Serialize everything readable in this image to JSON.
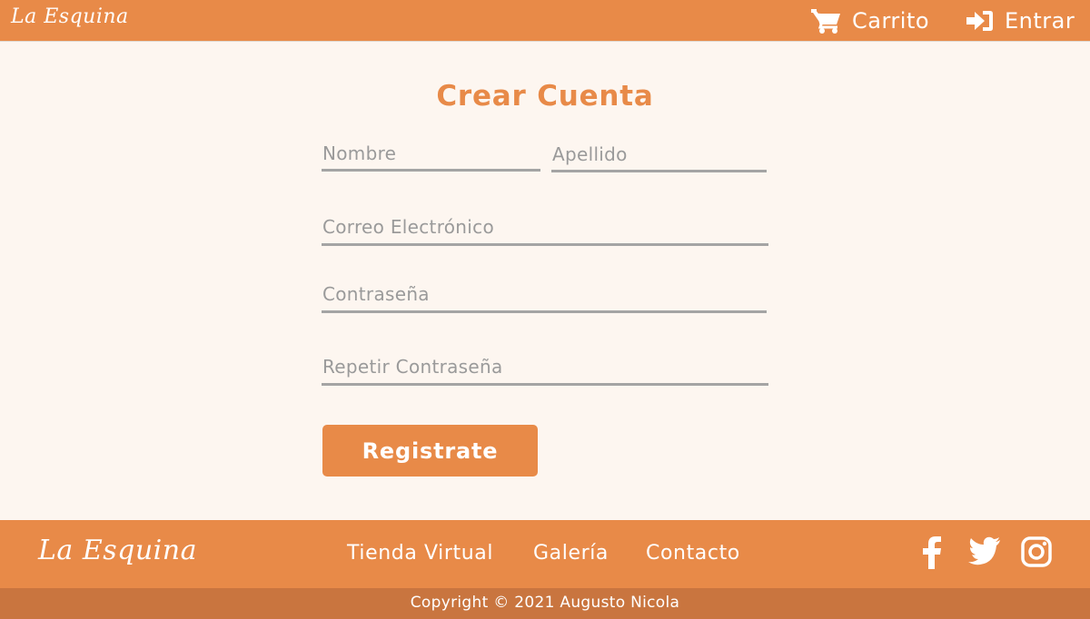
{
  "header": {
    "logo": "La Esquina",
    "cart_label": "Carrito",
    "login_label": "Entrar"
  },
  "form": {
    "title": "Crear Cuenta",
    "nombre_placeholder": "Nombre",
    "apellido_placeholder": "Apellido",
    "correo_placeholder": "Correo Electrónico",
    "password_placeholder": "Contraseña",
    "repeat_password_placeholder": "Repetir Contraseña",
    "submit_label": "Registrate"
  },
  "footer": {
    "logo": "La Esquina",
    "links": [
      "Tienda Virtual",
      "Galería",
      "Contacto"
    ],
    "social_icons": [
      "facebook-icon",
      "twitter-icon",
      "instagram-icon"
    ],
    "copyright": "Copyright © 2021 Augusto Nicola"
  },
  "colors": {
    "accent": "#e88a48",
    "accent_dark": "#c9753f",
    "background": "#fdf6f0",
    "field_line": "#a4a4a4"
  }
}
